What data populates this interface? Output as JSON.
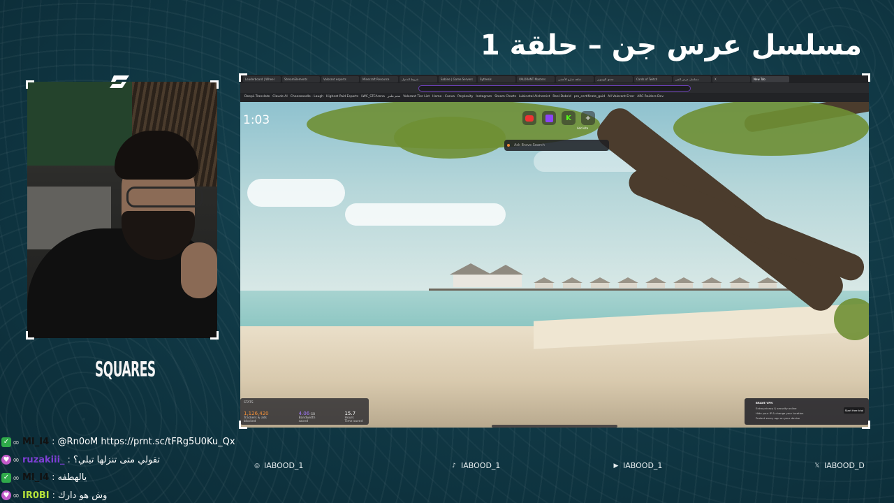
{
  "title": "مسلسل عرس جن – حلقة 1",
  "colors": {
    "accent": "#7e3fd6",
    "bg": "#113a47",
    "check": "#2faa4a",
    "heart": "#c25ac9"
  },
  "logo": "SQUARES",
  "screen": {
    "tabs": [
      "Leaderboard | Wheel",
      "StreamElements",
      "Valorant esports",
      "Minecraft Resource",
      "شروط الدخول",
      "Sabine | Game Servers",
      "Sythesis",
      "VALORANT Masters",
      "شاهد شارع الأعشى",
      "تحدي اليوتيوبر",
      "Cards of Twitch",
      "مسلسل عرس الجن",
      "X",
      "New Tab"
    ],
    "bookmarks": [
      "DeepL Translate",
      "Claude AI",
      "Cheeseoodle - Laugh",
      "Highest Paid Esports",
      "LWC_STCArena",
      "شتم فلمز",
      "Valorant Tier List",
      "Home - Canva",
      "Perplexity",
      "Instagram",
      "Steam Charts",
      "Lubinetal Alchemist",
      "Reel-Debrid",
      "pro_certificate_guid",
      "All Valorant Error",
      "ARC Raiders Dev"
    ],
    "clock": "1:03",
    "shortcut_label": "Add site",
    "search_placeholder": "Ask Brave Search",
    "stats": {
      "label": "STATS",
      "trackers_value": "1,126,420",
      "trackers_label": "Trackers & ads blocked",
      "bandwidth_value": "4.06",
      "bandwidth_unit": "GB",
      "bandwidth_label": "Bandwidth saved",
      "time_value": "15.7",
      "time_unit": "Hours",
      "time_label": "Time saved"
    },
    "vpn": {
      "title": "BRAVE VPN",
      "lines": [
        "Extra privacy & security online",
        "Hide your IP & change your location",
        "Protect every app on your device"
      ],
      "button": "Start free trial"
    }
  },
  "chat": [
    {
      "badge": "check",
      "user": "MI_I4",
      "user_color": "#111111",
      "text": "@Rn0oM https://prnt.sc/tFRg5U0Ku_Qx"
    },
    {
      "badge": "heart",
      "user": "ruzakiii_",
      "user_color": "#7e3fd6",
      "text": "تقولي متى تنزلها تبلي؟"
    },
    {
      "badge": "check",
      "user": "MI_I4",
      "user_color": "#111111",
      "text": "يالهطفه"
    },
    {
      "badge": "heart",
      "user": "IR0BI",
      "user_color": "#b6e23a",
      "text": "وش هو دارك"
    }
  ],
  "socials": [
    {
      "icon": "instagram-icon",
      "glyph": "◎",
      "handle": "IABOOD_1"
    },
    {
      "icon": "tiktok-icon",
      "glyph": "♪",
      "handle": "IABOOD_1"
    },
    {
      "icon": "youtube-icon",
      "glyph": "▶",
      "handle": "IABOOD_1"
    },
    {
      "icon": "x-icon",
      "glyph": "𝕏",
      "handle": "IABOOD_D"
    }
  ]
}
